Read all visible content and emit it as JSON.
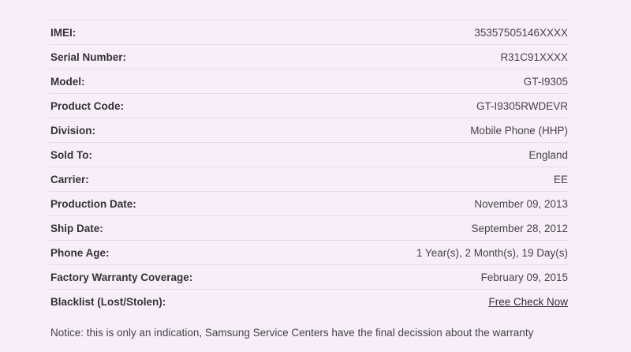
{
  "rows": [
    {
      "label": "IMEI:",
      "value": "35357505146XXXX"
    },
    {
      "label": "Serial Number:",
      "value": "R31C91XXXX"
    },
    {
      "label": "Model:",
      "value": "GT-I9305"
    },
    {
      "label": "Product Code:",
      "value": "GT-I9305RWDEVR"
    },
    {
      "label": "Division:",
      "value": "Mobile Phone (HHP)"
    },
    {
      "label": "Sold To:",
      "value": "England"
    },
    {
      "label": "Carrier:",
      "value": "EE"
    },
    {
      "label": "Production Date:",
      "value": "November 09, 2013"
    },
    {
      "label": "Ship Date:",
      "value": "September 28, 2012"
    },
    {
      "label": "Phone Age:",
      "value": "1 Year(s), 2 Month(s), 19 Day(s)"
    },
    {
      "label": "Factory Warranty Coverage:",
      "value": "February 09, 2015"
    },
    {
      "label": "Blacklist (Lost/Stolen):",
      "value": "Free Check Now"
    }
  ],
  "notice": "Notice: this is only an indication, Samsung Service Centers have the final decission about the warranty"
}
